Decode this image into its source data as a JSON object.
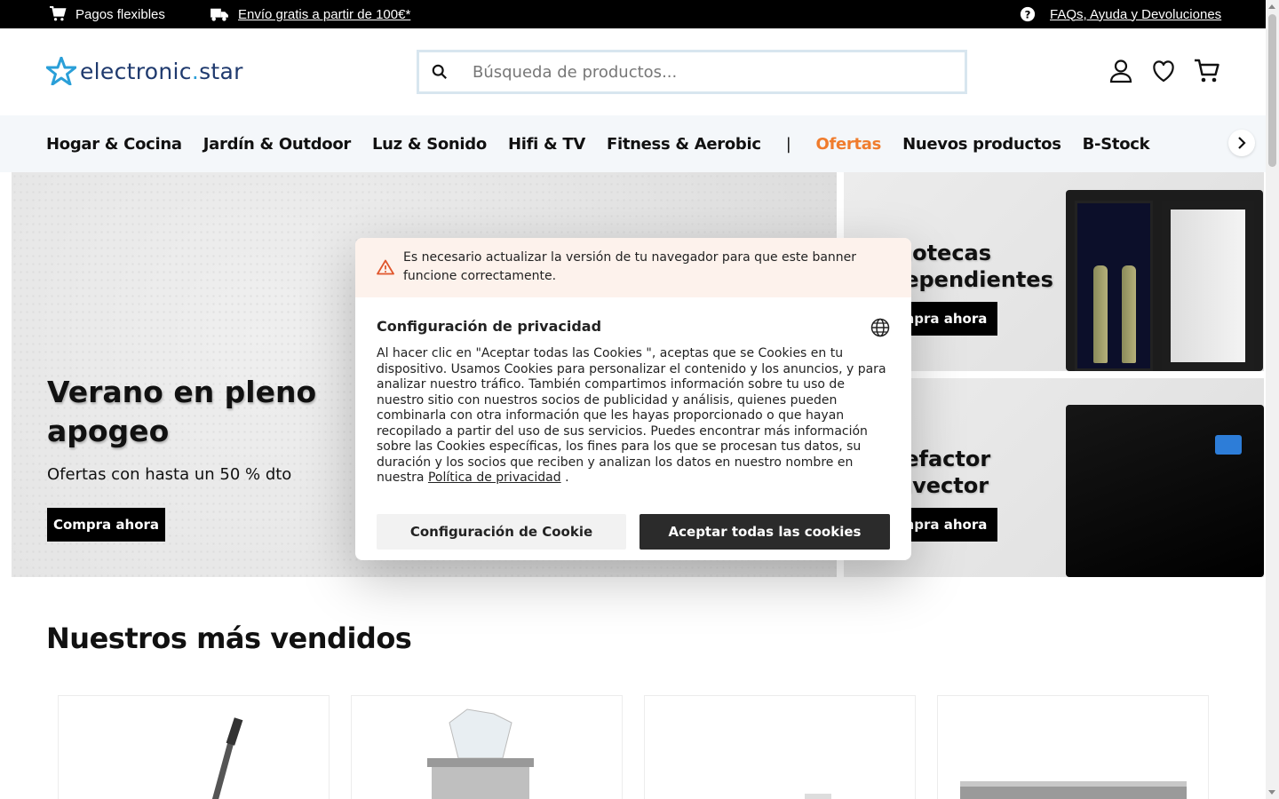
{
  "topbar": {
    "payments": "Pagos flexibles",
    "shipping": "Envío gratis a partir de 100€*",
    "help": "FAQs, Ayuda y Devoluciones"
  },
  "header": {
    "logo_part1": "electronic",
    "logo_dot": ".",
    "logo_part2": "star",
    "search_placeholder": "Búsqueda de productos...",
    "icons": [
      "user-icon",
      "heart-icon",
      "cart-icon"
    ]
  },
  "nav": {
    "items": [
      "Hogar & Cocina",
      "Jardín & Outdoor",
      "Luz & Sonido",
      "Hifi & TV",
      "Fitness & Aerobic",
      "|",
      "Ofertas",
      "Nuevos productos",
      "B-Stock"
    ]
  },
  "hero": {
    "title": "Verano en pleno apogeo",
    "subtitle": "Ofertas con hasta un 50 % dto",
    "cta": "Compra ahora"
  },
  "promos": [
    {
      "title_line1": "notecas",
      "title_line2": "lependientes",
      "cta": "mpra ahora"
    },
    {
      "title_line1": "lefactor",
      "title_line2": "nvector",
      "cta": "mpra ahora"
    }
  ],
  "bestsellers": {
    "title": "Nuestros más vendidos"
  },
  "cookie_modal": {
    "warning": "Es necesario actualizar la versión de tu navegador para que este banner funcione correctamente.",
    "title": "Configuración de privacidad",
    "body": "Al hacer clic en \"Aceptar todas las Cookies \", aceptas que se Cookies en tu dispositivo. Usamos Cookies para personalizar el contenido y los anuncios, y para analizar nuestro tráfico. También compartimos información sobre tu uso de nuestro sitio con nuestros socios de publicidad y análisis, quienes pueden combinarla con otra información que les hayas proporcionado o que hayan recopilado a partir del uso de sus servicios. Puedes encontrar más información sobre las Cookies específicas, los fines para los que se procesan tus datos, su duración y los socios que reciben y analizan los datos en nuestro nombre en nuestra",
    "policy_link": "Política de privacidad",
    "body_end": ".",
    "settings_button": "Configuración de Cookie",
    "accept_button": "Aceptar todas las cookies"
  },
  "colors": {
    "accent_orange": "#f07c2d",
    "logo_blue": "#1f3a6e",
    "logo_star": "#2a9fd8"
  }
}
